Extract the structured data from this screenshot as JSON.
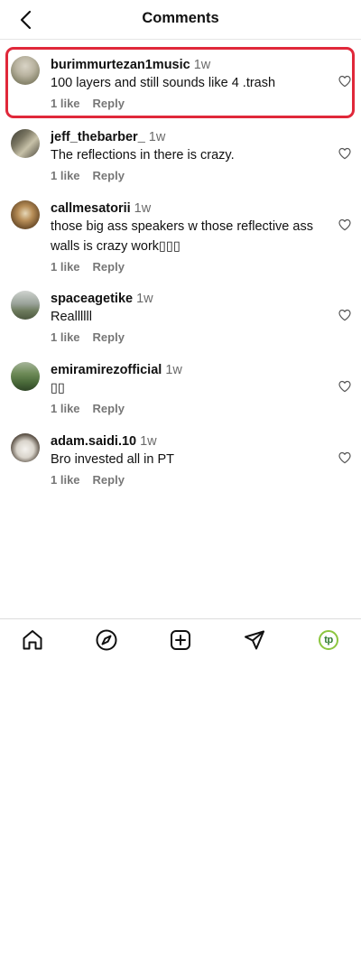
{
  "header": {
    "title": "Comments"
  },
  "comments": [
    {
      "username": "burimmurtezan1music",
      "time": "1w",
      "text": "100 layers and still sounds like 4 .trash",
      "likes": "1 like",
      "reply": "Reply"
    },
    {
      "username": "jeff_thebarber_",
      "time": "1w",
      "text": "The reflections in there is crazy.",
      "likes": "1 like",
      "reply": "Reply"
    },
    {
      "username": "callmesatorii",
      "time": "1w",
      "text": "those big ass speakers w those reflective ass walls is crazy work▯▯▯",
      "likes": "1 like",
      "reply": "Reply"
    },
    {
      "username": "spaceagetike",
      "time": "1w",
      "text": "Reallllll",
      "likes": "1 like",
      "reply": "Reply"
    },
    {
      "username": "emiramirezofficial",
      "time": "1w",
      "text": "▯▯",
      "likes": "1 like",
      "reply": "Reply"
    },
    {
      "username": "adam.saidi.10",
      "time": "1w",
      "text": "Bro invested all in PT",
      "likes": "1 like",
      "reply": "Reply"
    }
  ],
  "tabbar": {
    "icons": [
      "home-icon",
      "explore-icon",
      "create-icon",
      "direct-icon",
      "profile-icon"
    ],
    "profile_initials": "tp"
  },
  "colors": {
    "highlight": "#e0283a",
    "profile_ring": "#8cc63f"
  }
}
